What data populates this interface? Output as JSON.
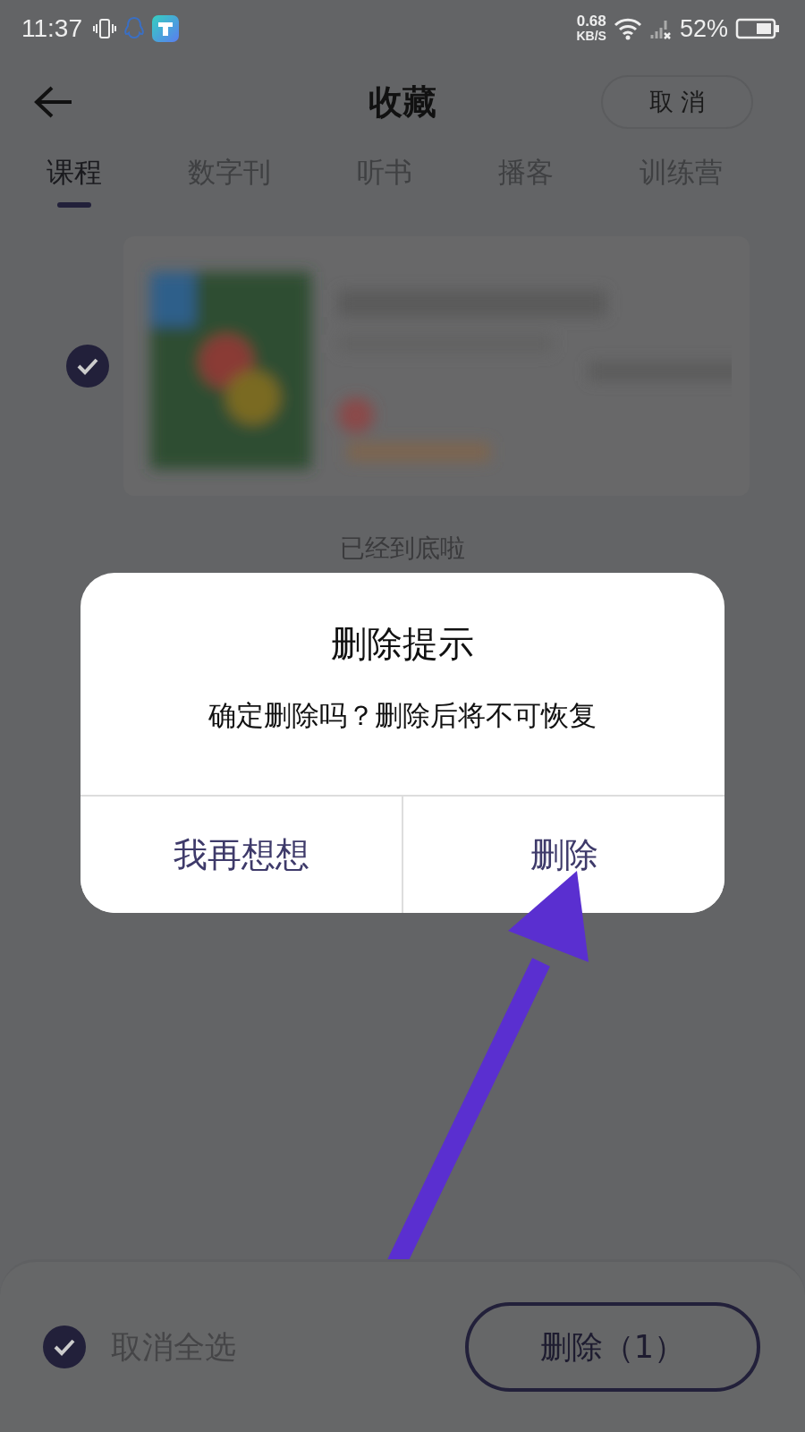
{
  "status_bar": {
    "time": "11:37",
    "speed_value": "0.68",
    "speed_unit": "KB/S",
    "battery": "52%"
  },
  "header": {
    "title": "收藏",
    "cancel_button": "取 消"
  },
  "tabs": [
    {
      "label": "课程",
      "selected": true
    },
    {
      "label": "数字刊",
      "selected": false
    },
    {
      "label": "听书",
      "selected": false
    },
    {
      "label": "播客",
      "selected": false
    },
    {
      "label": "训练营",
      "selected": false
    }
  ],
  "items": [
    {
      "kind": "picture",
      "checked": true
    }
  ],
  "end_note": "已经到底啦",
  "dialog": {
    "title": "删除提示",
    "message": "确定删除吗？删除后将不可恢复",
    "buttons": [
      "我再想想",
      "删除"
    ]
  },
  "bottom_bar": {
    "select_all_checked": true,
    "select_all_label": "取消全选",
    "delete_button": "删除（1）"
  }
}
